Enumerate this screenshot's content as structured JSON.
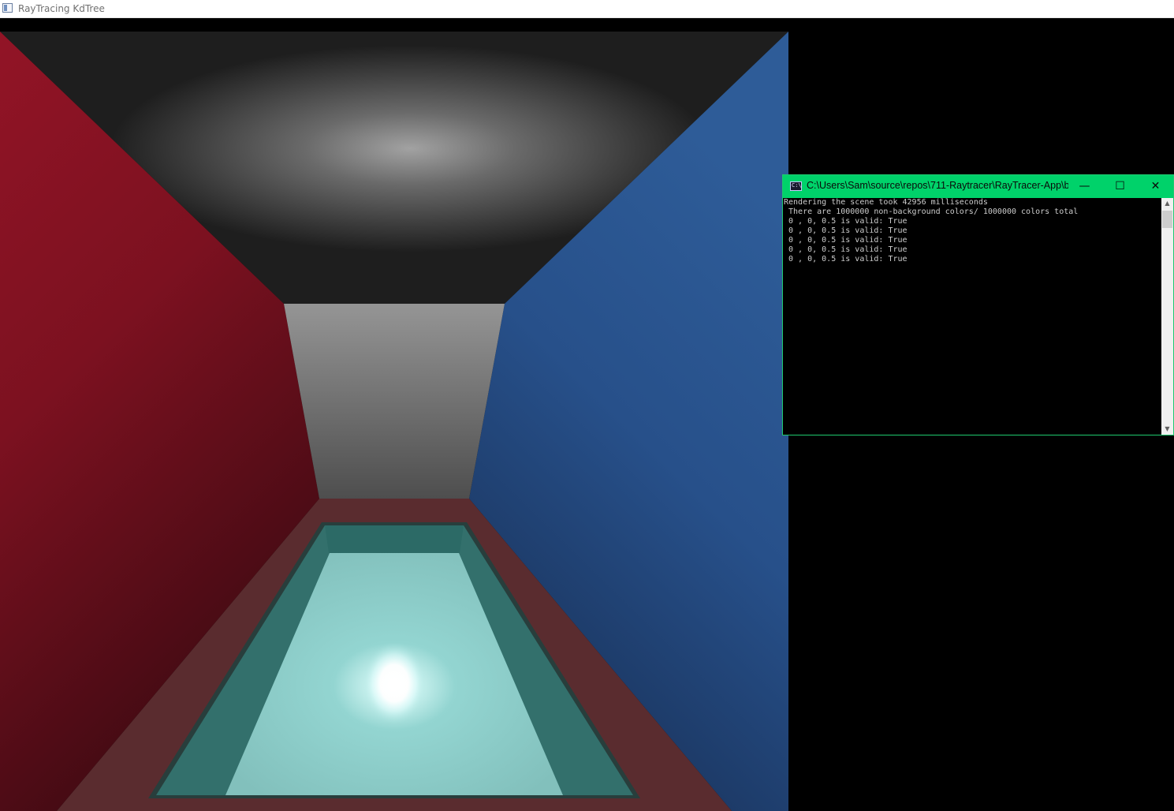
{
  "app": {
    "title": "RayTracing KdTree",
    "icon": "window-icon"
  },
  "console": {
    "icon": "console-icon",
    "icon_glyph": "C:\\",
    "title": "C:\\Users\\Sam\\source\\repos\\711-Raytracer\\RayTracer-App\\bi...",
    "minimize_glyph": "—",
    "maximize_glyph": "☐",
    "close_glyph": "✕",
    "lines": [
      "Rendering the scene took 42956 milliseconds",
      " There are 1000000 non-background colors/ 1000000 colors total",
      " 0 , 0, 0.5 is valid: True",
      " 0 , 0, 0.5 is valid: True",
      " 0 , 0, 0.5 is valid: True",
      " 0 , 0, 0.5 is valid: True",
      " 0 , 0, 0.5 is valid: True"
    ],
    "scroll_up_glyph": "▲",
    "scroll_down_glyph": "▼",
    "accent_color": "#00d26a"
  },
  "scene": {
    "left_wall_color": "#8c1426",
    "right_wall_color": "#2b5a96",
    "ceiling_color": "#2a2a2a",
    "back_wall_color": "#8a8a8a",
    "floor_frame_color": "#5a2b2e",
    "water_color": "#8ed0cc",
    "water_inner_edge_color": "#2f6e6a"
  }
}
